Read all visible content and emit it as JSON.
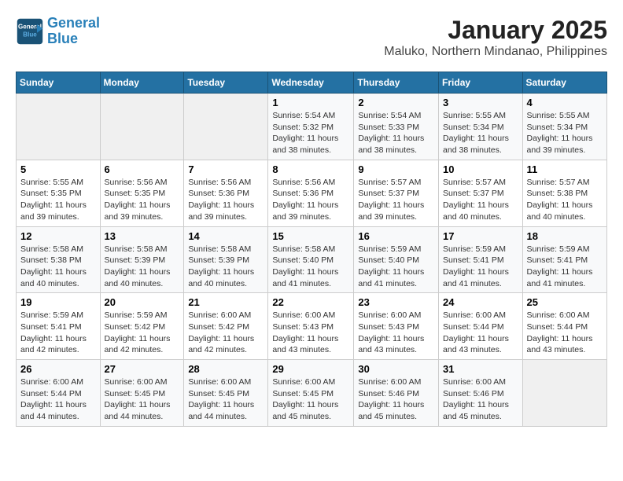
{
  "header": {
    "logo_line1": "General",
    "logo_line2": "Blue",
    "title": "January 2025",
    "subtitle": "Maluko, Northern Mindanao, Philippines"
  },
  "weekdays": [
    "Sunday",
    "Monday",
    "Tuesday",
    "Wednesday",
    "Thursday",
    "Friday",
    "Saturday"
  ],
  "weeks": [
    [
      {
        "day": "",
        "sunrise": "",
        "sunset": "",
        "daylight": "",
        "empty": true
      },
      {
        "day": "",
        "sunrise": "",
        "sunset": "",
        "daylight": "",
        "empty": true
      },
      {
        "day": "",
        "sunrise": "",
        "sunset": "",
        "daylight": "",
        "empty": true
      },
      {
        "day": "1",
        "sunrise": "Sunrise: 5:54 AM",
        "sunset": "Sunset: 5:32 PM",
        "daylight": "Daylight: 11 hours and 38 minutes.",
        "empty": false
      },
      {
        "day": "2",
        "sunrise": "Sunrise: 5:54 AM",
        "sunset": "Sunset: 5:33 PM",
        "daylight": "Daylight: 11 hours and 38 minutes.",
        "empty": false
      },
      {
        "day": "3",
        "sunrise": "Sunrise: 5:55 AM",
        "sunset": "Sunset: 5:34 PM",
        "daylight": "Daylight: 11 hours and 38 minutes.",
        "empty": false
      },
      {
        "day": "4",
        "sunrise": "Sunrise: 5:55 AM",
        "sunset": "Sunset: 5:34 PM",
        "daylight": "Daylight: 11 hours and 39 minutes.",
        "empty": false
      }
    ],
    [
      {
        "day": "5",
        "sunrise": "Sunrise: 5:55 AM",
        "sunset": "Sunset: 5:35 PM",
        "daylight": "Daylight: 11 hours and 39 minutes.",
        "empty": false
      },
      {
        "day": "6",
        "sunrise": "Sunrise: 5:56 AM",
        "sunset": "Sunset: 5:35 PM",
        "daylight": "Daylight: 11 hours and 39 minutes.",
        "empty": false
      },
      {
        "day": "7",
        "sunrise": "Sunrise: 5:56 AM",
        "sunset": "Sunset: 5:36 PM",
        "daylight": "Daylight: 11 hours and 39 minutes.",
        "empty": false
      },
      {
        "day": "8",
        "sunrise": "Sunrise: 5:56 AM",
        "sunset": "Sunset: 5:36 PM",
        "daylight": "Daylight: 11 hours and 39 minutes.",
        "empty": false
      },
      {
        "day": "9",
        "sunrise": "Sunrise: 5:57 AM",
        "sunset": "Sunset: 5:37 PM",
        "daylight": "Daylight: 11 hours and 39 minutes.",
        "empty": false
      },
      {
        "day": "10",
        "sunrise": "Sunrise: 5:57 AM",
        "sunset": "Sunset: 5:37 PM",
        "daylight": "Daylight: 11 hours and 40 minutes.",
        "empty": false
      },
      {
        "day": "11",
        "sunrise": "Sunrise: 5:57 AM",
        "sunset": "Sunset: 5:38 PM",
        "daylight": "Daylight: 11 hours and 40 minutes.",
        "empty": false
      }
    ],
    [
      {
        "day": "12",
        "sunrise": "Sunrise: 5:58 AM",
        "sunset": "Sunset: 5:38 PM",
        "daylight": "Daylight: 11 hours and 40 minutes.",
        "empty": false
      },
      {
        "day": "13",
        "sunrise": "Sunrise: 5:58 AM",
        "sunset": "Sunset: 5:39 PM",
        "daylight": "Daylight: 11 hours and 40 minutes.",
        "empty": false
      },
      {
        "day": "14",
        "sunrise": "Sunrise: 5:58 AM",
        "sunset": "Sunset: 5:39 PM",
        "daylight": "Daylight: 11 hours and 40 minutes.",
        "empty": false
      },
      {
        "day": "15",
        "sunrise": "Sunrise: 5:58 AM",
        "sunset": "Sunset: 5:40 PM",
        "daylight": "Daylight: 11 hours and 41 minutes.",
        "empty": false
      },
      {
        "day": "16",
        "sunrise": "Sunrise: 5:59 AM",
        "sunset": "Sunset: 5:40 PM",
        "daylight": "Daylight: 11 hours and 41 minutes.",
        "empty": false
      },
      {
        "day": "17",
        "sunrise": "Sunrise: 5:59 AM",
        "sunset": "Sunset: 5:41 PM",
        "daylight": "Daylight: 11 hours and 41 minutes.",
        "empty": false
      },
      {
        "day": "18",
        "sunrise": "Sunrise: 5:59 AM",
        "sunset": "Sunset: 5:41 PM",
        "daylight": "Daylight: 11 hours and 41 minutes.",
        "empty": false
      }
    ],
    [
      {
        "day": "19",
        "sunrise": "Sunrise: 5:59 AM",
        "sunset": "Sunset: 5:41 PM",
        "daylight": "Daylight: 11 hours and 42 minutes.",
        "empty": false
      },
      {
        "day": "20",
        "sunrise": "Sunrise: 5:59 AM",
        "sunset": "Sunset: 5:42 PM",
        "daylight": "Daylight: 11 hours and 42 minutes.",
        "empty": false
      },
      {
        "day": "21",
        "sunrise": "Sunrise: 6:00 AM",
        "sunset": "Sunset: 5:42 PM",
        "daylight": "Daylight: 11 hours and 42 minutes.",
        "empty": false
      },
      {
        "day": "22",
        "sunrise": "Sunrise: 6:00 AM",
        "sunset": "Sunset: 5:43 PM",
        "daylight": "Daylight: 11 hours and 43 minutes.",
        "empty": false
      },
      {
        "day": "23",
        "sunrise": "Sunrise: 6:00 AM",
        "sunset": "Sunset: 5:43 PM",
        "daylight": "Daylight: 11 hours and 43 minutes.",
        "empty": false
      },
      {
        "day": "24",
        "sunrise": "Sunrise: 6:00 AM",
        "sunset": "Sunset: 5:44 PM",
        "daylight": "Daylight: 11 hours and 43 minutes.",
        "empty": false
      },
      {
        "day": "25",
        "sunrise": "Sunrise: 6:00 AM",
        "sunset": "Sunset: 5:44 PM",
        "daylight": "Daylight: 11 hours and 43 minutes.",
        "empty": false
      }
    ],
    [
      {
        "day": "26",
        "sunrise": "Sunrise: 6:00 AM",
        "sunset": "Sunset: 5:44 PM",
        "daylight": "Daylight: 11 hours and 44 minutes.",
        "empty": false
      },
      {
        "day": "27",
        "sunrise": "Sunrise: 6:00 AM",
        "sunset": "Sunset: 5:45 PM",
        "daylight": "Daylight: 11 hours and 44 minutes.",
        "empty": false
      },
      {
        "day": "28",
        "sunrise": "Sunrise: 6:00 AM",
        "sunset": "Sunset: 5:45 PM",
        "daylight": "Daylight: 11 hours and 44 minutes.",
        "empty": false
      },
      {
        "day": "29",
        "sunrise": "Sunrise: 6:00 AM",
        "sunset": "Sunset: 5:45 PM",
        "daylight": "Daylight: 11 hours and 45 minutes.",
        "empty": false
      },
      {
        "day": "30",
        "sunrise": "Sunrise: 6:00 AM",
        "sunset": "Sunset: 5:46 PM",
        "daylight": "Daylight: 11 hours and 45 minutes.",
        "empty": false
      },
      {
        "day": "31",
        "sunrise": "Sunrise: 6:00 AM",
        "sunset": "Sunset: 5:46 PM",
        "daylight": "Daylight: 11 hours and 45 minutes.",
        "empty": false
      },
      {
        "day": "",
        "sunrise": "",
        "sunset": "",
        "daylight": "",
        "empty": true
      }
    ]
  ]
}
